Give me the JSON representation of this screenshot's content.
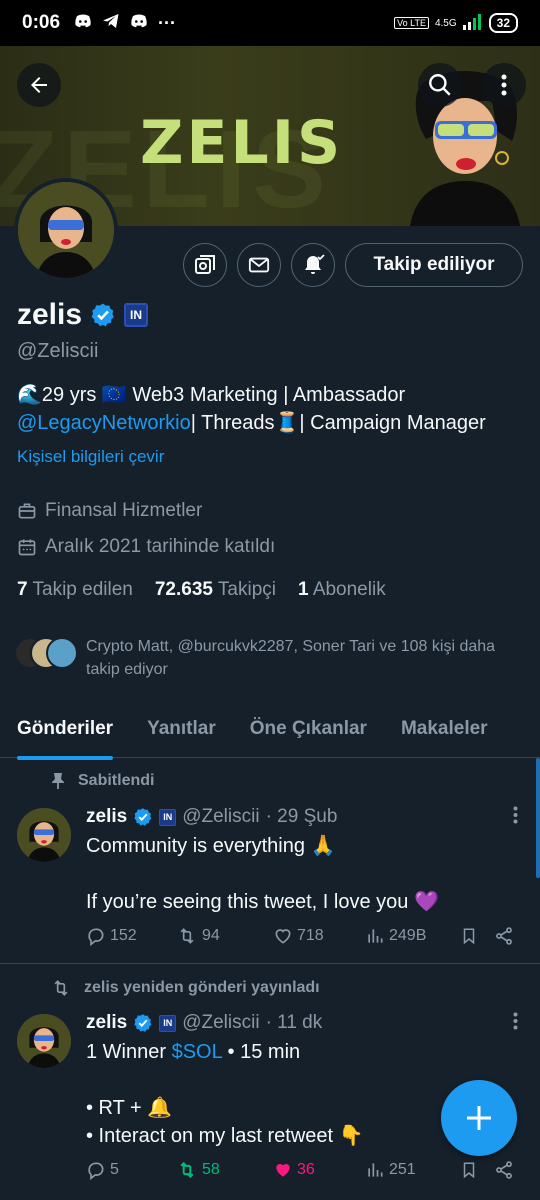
{
  "status_bar": {
    "time": "0:06",
    "overflow": "···",
    "network": "4.5G",
    "volte": "Vo LTE",
    "battery": "32"
  },
  "banner": {
    "title": "ZELIS"
  },
  "profile": {
    "follow_button": "Takip ediliyor",
    "name": "zelis",
    "handle": "@Zeliscii",
    "bio_line1": "🌊29 yrs 🇪🇺 Web3 Marketing | Ambassador",
    "bio_mention": "@LegacyNetworkio",
    "bio_line2_rest": "| Threads🧵| Campaign Manager",
    "translate_label": "Kişisel bilgileri çevir",
    "category": "Finansal Hizmetler",
    "joined": "Aralık 2021 tarihinde katıldı",
    "following_count": "7",
    "following_label": "Takip edilen",
    "followers_count": "72.635",
    "followers_label": "Takipçi",
    "subs_count": "1",
    "subs_label": "Abonelik",
    "known_followers": "Crypto Matt, @burcukvk2287, Soner Tari ve 108 kişi daha takip ediyor"
  },
  "tabs": [
    "Gönderiler",
    "Yanıtlar",
    "Öne Çıkanlar",
    "Makaleler"
  ],
  "tweets": [
    {
      "social": "Sabitlendi",
      "name": "zelis",
      "handle": "@Zeliscii",
      "time": "· 29 Şub",
      "line1": "Community is everything 🙏",
      "line2": "If you’re seeing this tweet, I love you 💜",
      "replies": "152",
      "retweets": "94",
      "likes": "718",
      "views": "249B"
    },
    {
      "social": "zelis yeniden gönderi yayınladı",
      "name": "zelis",
      "handle": "@Zeliscii",
      "time": "· 11 dk",
      "line1_pre": "1 Winner ",
      "line1_tag": "$SOL",
      "line1_post": " • 15 min",
      "line2": "• RT + 🔔",
      "line3": "• Interact on my last retweet 👇",
      "replies": "5",
      "retweets": "58",
      "likes": "36",
      "views": "251"
    }
  ],
  "colors": {
    "background": "#15202b",
    "accent": "#1d9bf0",
    "retweet_active": "#00ba7c",
    "like_active": "#f91880",
    "banner_text": "#c5df7a"
  },
  "icons": [
    "back-arrow-icon",
    "search-icon",
    "more-vertical-icon",
    "grok-icon",
    "mail-icon",
    "bell-icon",
    "verified-icon",
    "briefcase-icon",
    "calendar-icon",
    "pin-icon",
    "retweet-icon",
    "reply-icon",
    "like-icon",
    "views-icon",
    "bookmark-icon",
    "share-icon",
    "plus-icon"
  ]
}
